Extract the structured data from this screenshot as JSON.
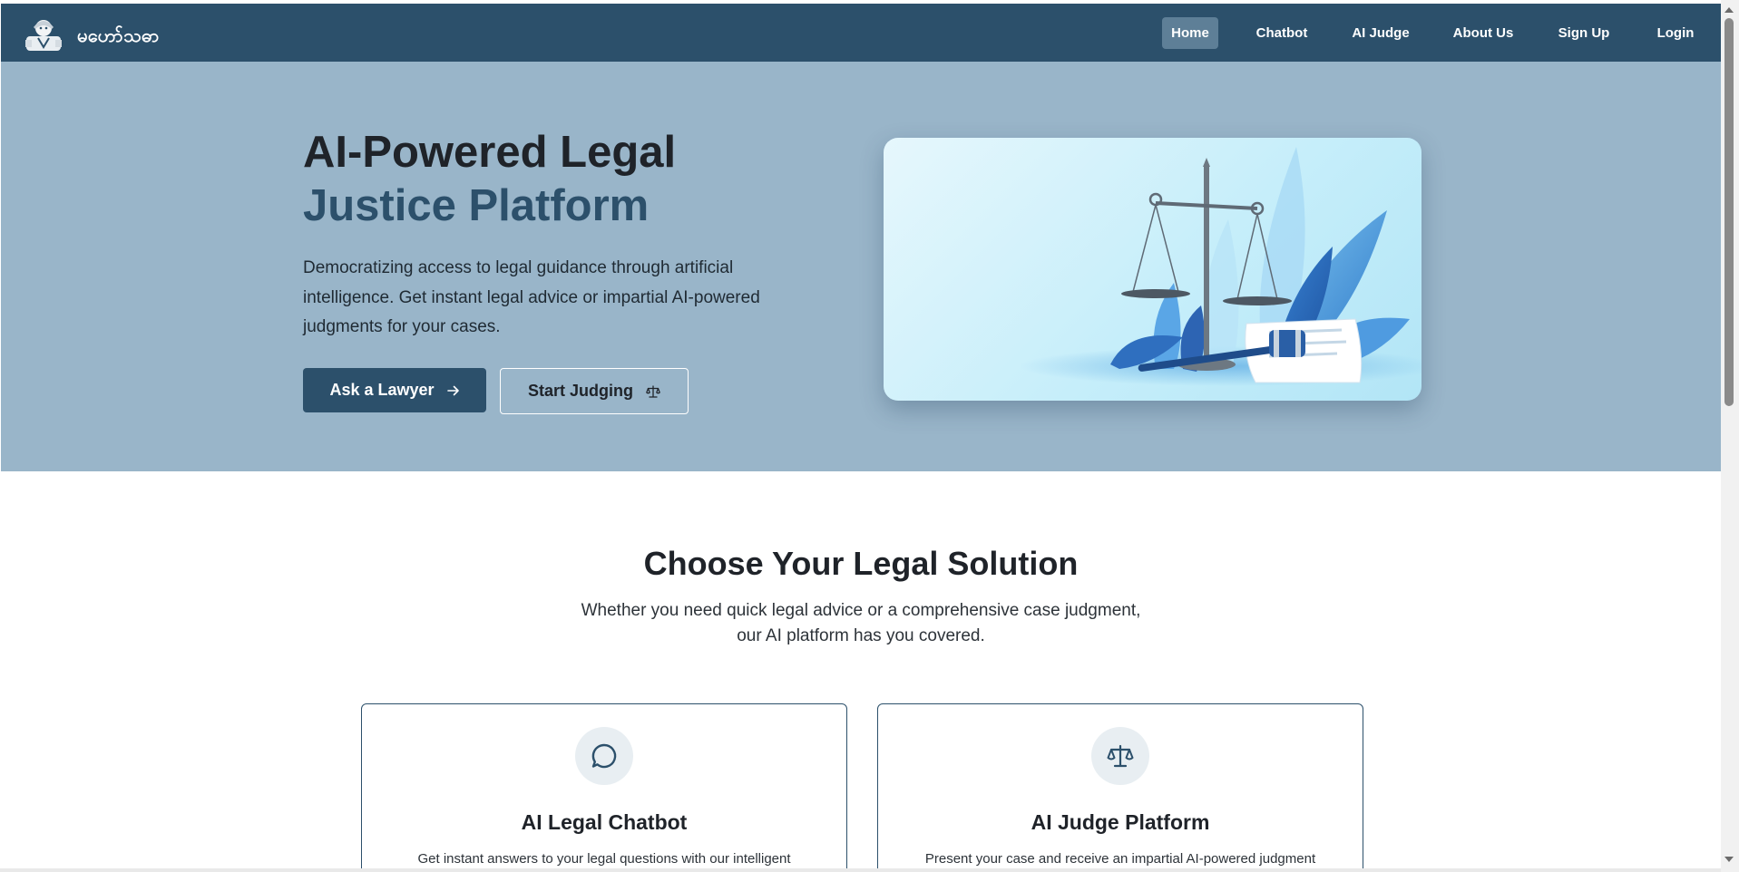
{
  "navbar": {
    "brand": "မဟော်သဓာ",
    "logo_icon": "lawyer-avatar-icon",
    "items": [
      {
        "label": "Home",
        "active": true
      },
      {
        "label": "Chatbot",
        "active": false
      },
      {
        "label": "AI Judge",
        "active": false
      },
      {
        "label": "About Us",
        "active": false
      },
      {
        "label": "Sign Up",
        "active": false
      },
      {
        "label": "Login",
        "active": false
      }
    ]
  },
  "hero": {
    "title_line1": "AI-Powered Legal",
    "title_line2": "Justice Platform",
    "description": "Democratizing access to legal guidance through artificial intelligence. Get instant legal advice or impartial AI-powered judgments for your cases.",
    "primary_button": {
      "label": "Ask a Lawyer",
      "icon": "arrow-right-icon"
    },
    "secondary_button": {
      "label": "Start Judging",
      "icon": "scale-icon"
    },
    "image": "justice-scales-gavel-illustration"
  },
  "solutions": {
    "title": "Choose Your Legal Solution",
    "subtitle_line1": "Whether you need quick legal advice or a comprehensive case judgment,",
    "subtitle_line2": "our AI platform has you covered.",
    "cards": [
      {
        "icon": "chat-bubble-icon",
        "title": "AI Legal Chatbot",
        "description": "Get instant answers to your legal questions with our intelligent"
      },
      {
        "icon": "scale-icon",
        "title": "AI Judge Platform",
        "description": "Present your case and receive an impartial AI-powered judgment"
      }
    ]
  },
  "colors": {
    "primary": "#2c506b",
    "hero_background": "#99b5c9",
    "nav_active": "#5e7f97"
  }
}
